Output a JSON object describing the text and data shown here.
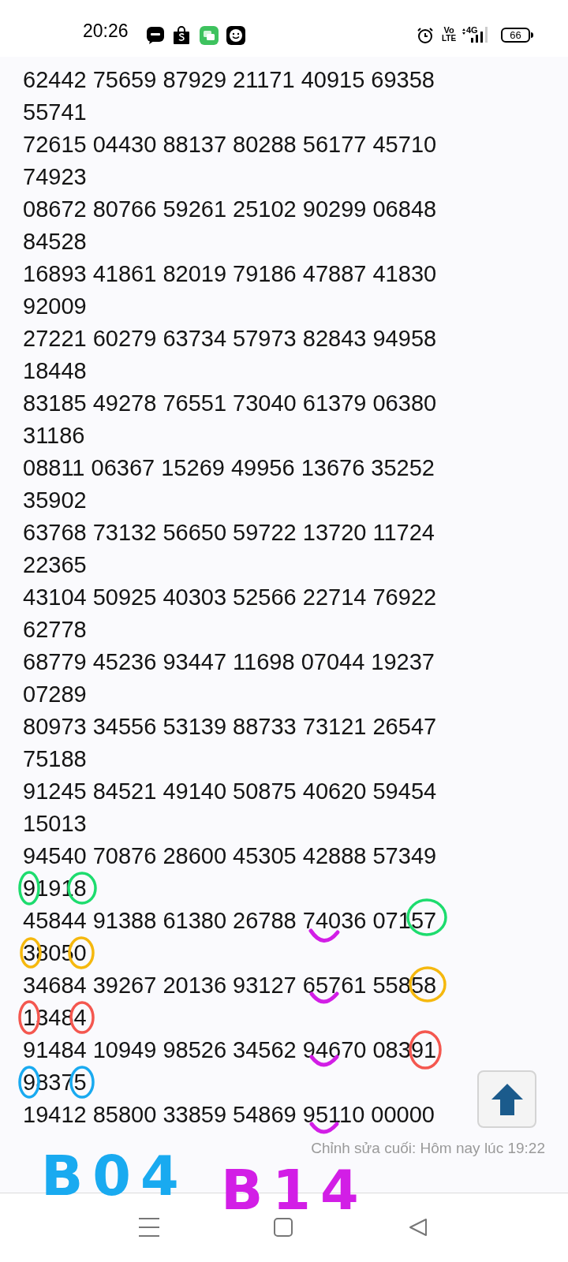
{
  "status_bar": {
    "time": "20:26",
    "volte_top": "Vo",
    "volte_bottom": "LTE",
    "network": "4G",
    "battery": "66"
  },
  "rows": [
    "62442 75659 87929 21171 40915 69358 55741",
    "72615 04430 88137 80288 56177 45710 74923",
    "08672 80766 59261 25102 90299 06848 84528",
    "16893 41861 82019 79186 47887 41830 92009",
    "27221 60279 63734 57973 82843 94958 18448",
    "83185 49278 76551 73040 61379 06380 31186",
    "08811 06367 15269 49956 13676 35252 35902",
    "63768 73132 56650 59722 13720 11724 22365",
    "43104 50925 40303 52566 22714 76922 62778",
    "68779 45236 93447 11698 07044 19237 07289",
    "80973 34556 53139 88733 73121 26547 75188",
    "91245 84521 49140 50875 40620 59454 15013",
    "94540 70876 28600 45305 42888 57349 91918",
    "45844 91388 61380 26788 74036 07157 38050",
    "34684 39267 20136 93127 65761 55858 13484",
    "91484 10949 98526 34562 94670 08391 98375",
    "19412 85800 33859 54869 95110 00000"
  ],
  "edit_note": "Chỉnh sửa cuối: Hôm nay lúc 19:22",
  "annotations": [
    {
      "text": "B04",
      "color": "#19aaf0"
    },
    {
      "text": "B14",
      "color": "#d21ee6"
    }
  ]
}
